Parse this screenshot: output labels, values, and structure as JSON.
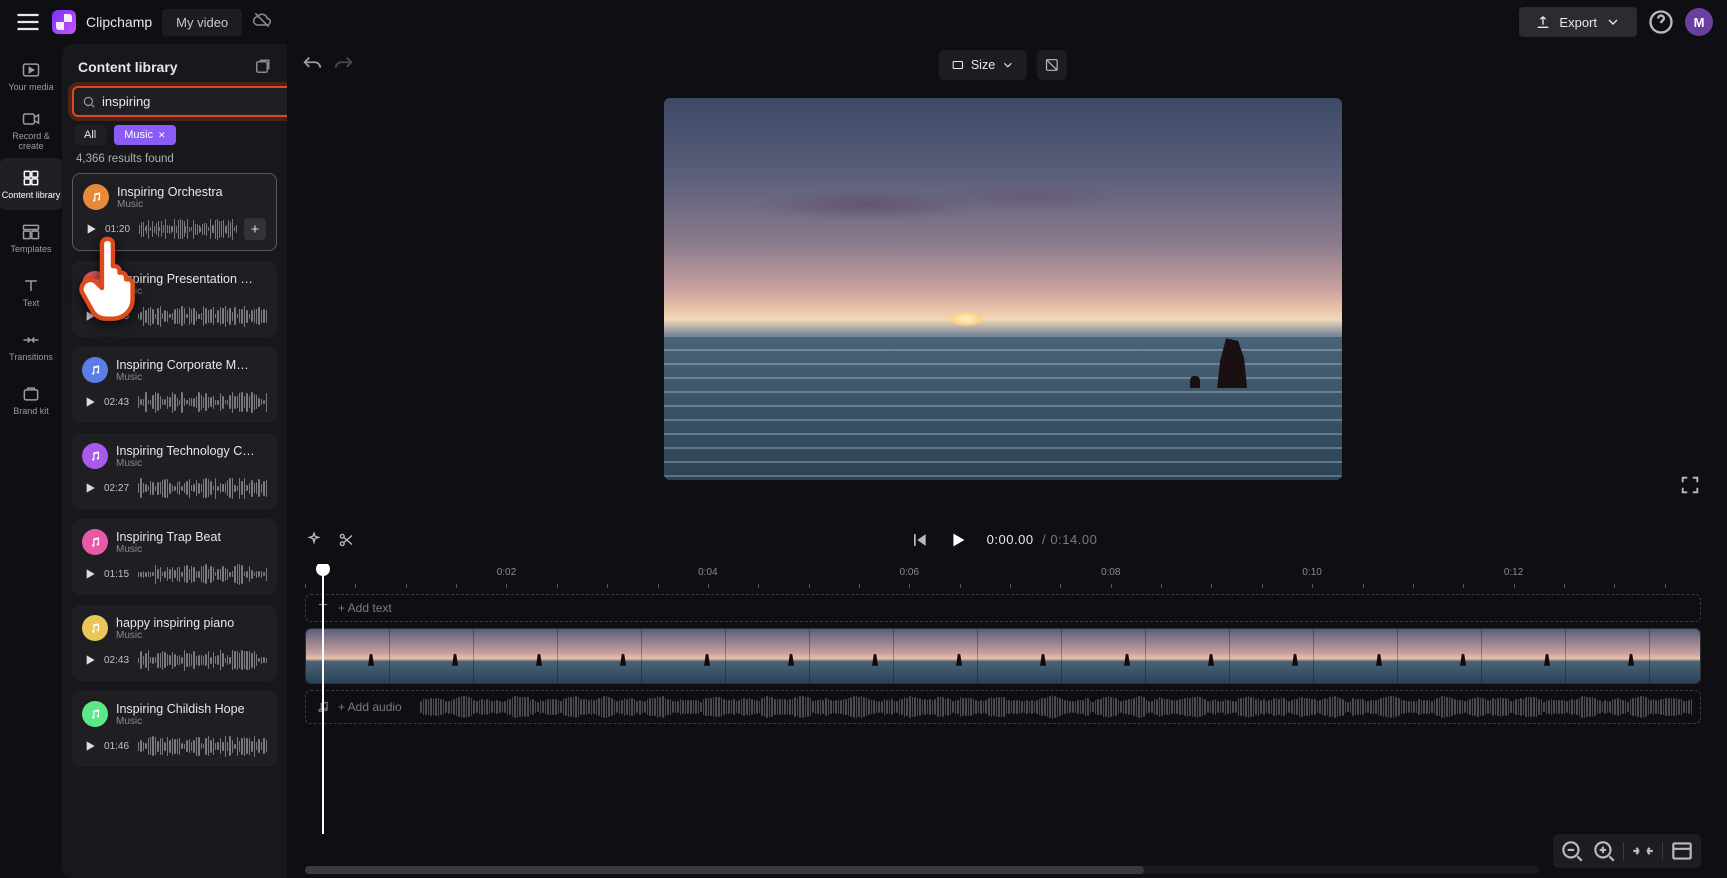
{
  "brand": "Clipchamp",
  "project_name": "My video",
  "export_label": "Export",
  "avatar_initial": "M",
  "nav": [
    {
      "id": "your-media",
      "label": "Your media"
    },
    {
      "id": "record-create",
      "label": "Record & create"
    },
    {
      "id": "content-library",
      "label": "Content library"
    },
    {
      "id": "templates",
      "label": "Templates"
    },
    {
      "id": "text",
      "label": "Text"
    },
    {
      "id": "transitions",
      "label": "Transitions"
    },
    {
      "id": "brand-kit",
      "label": "Brand kit"
    }
  ],
  "panel": {
    "title": "Content library",
    "search_value": "inspiring",
    "chips": {
      "all": "All",
      "music": "Music"
    },
    "results_count": "4,366 results found",
    "tracks": [
      {
        "title": "Inspiring Orchestra",
        "sub": "Music",
        "dur": "01:20",
        "color": "#e8893a"
      },
      {
        "title": "Inspiring Presentation …",
        "sub": "Music",
        "dur": "01:55",
        "color": "#e85a5a"
      },
      {
        "title": "Inspiring Corporate M…",
        "sub": "Music",
        "dur": "02:43",
        "color": "#5a7de8"
      },
      {
        "title": "Inspiring Technology C…",
        "sub": "Music",
        "dur": "02:27",
        "color": "#a85ae8"
      },
      {
        "title": "Inspiring Trap Beat",
        "sub": "Music",
        "dur": "01:15",
        "color": "#e85aa8"
      },
      {
        "title": "happy inspiring piano",
        "sub": "Music",
        "dur": "02:43",
        "color": "#e8c65a"
      },
      {
        "title": "Inspiring Childish Hope",
        "sub": "Music",
        "dur": "01:46",
        "color": "#5ae88a"
      }
    ]
  },
  "stage": {
    "size_label": "Size"
  },
  "transport": {
    "current": "0:00.00",
    "sep": "/",
    "total": "0:14.00"
  },
  "ruler": [
    "0:02",
    "0:04",
    "0:06",
    "0:08",
    "0:10",
    "0:12"
  ],
  "lanes": {
    "text": "+ Add text",
    "audio": "+ Add audio"
  }
}
